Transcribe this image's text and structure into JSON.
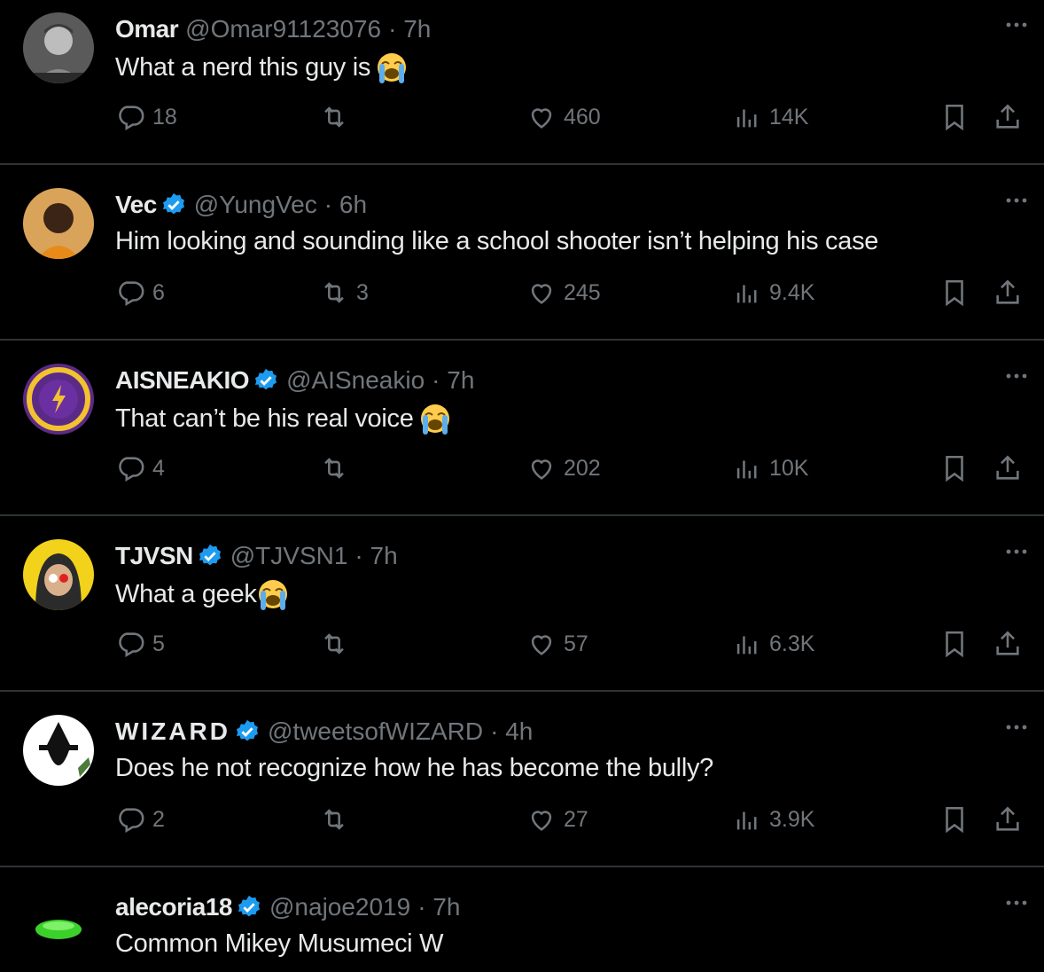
{
  "tweets": [
    {
      "name": "Omar",
      "verified": false,
      "handle": "@Omar91123076",
      "time": "· 7h",
      "text": "What a nerd this guy is",
      "emoji": "loudly-crying-face",
      "replies": "18",
      "retweets": "",
      "likes": "460",
      "views": "14K"
    },
    {
      "name": "Vec",
      "verified": true,
      "handle": "@YungVec",
      "time": "· 6h",
      "text": "Him looking and sounding like a school shooter isn’t helping his case",
      "emoji": "",
      "replies": "6",
      "retweets": "3",
      "likes": "245",
      "views": "9.4K"
    },
    {
      "name": "AISNEAKIO",
      "verified": true,
      "handle": "@AISneakio",
      "time": "· 7h",
      "text": "That can’t be his real voice",
      "emoji": "loudly-crying-face",
      "replies": "4",
      "retweets": "",
      "likes": "202",
      "views": "10K"
    },
    {
      "name": "TJVSN",
      "verified": true,
      "handle": "@TJVSN1",
      "time": "· 7h",
      "text": "What a geek",
      "emoji": "loudly-crying-face",
      "replies": "5",
      "retweets": "",
      "likes": "57",
      "views": "6.3K"
    },
    {
      "name": "WIZARD",
      "verified": true,
      "handle": "@tweetsofWIZARD",
      "time": "· 4h",
      "text": "Does he not recognize how he has become the bully?",
      "emoji": "",
      "replies": "2",
      "retweets": "",
      "likes": "27",
      "views": "3.9K"
    },
    {
      "name": "alecoria18",
      "verified": true,
      "handle": "@najoe2019",
      "time": "· 7h",
      "text": "Common Mikey Musumeci W",
      "emoji": ""
    }
  ],
  "colors": {
    "background": "#000000",
    "text": "#e7e9ea",
    "muted": "#71767b",
    "divider": "#2f3336",
    "verified": "#1d9bf0"
  },
  "icons": {
    "reply": "reply-icon",
    "retweet": "retweet-icon",
    "like": "heart-icon",
    "views": "views-icon",
    "bookmark": "bookmark-icon",
    "share": "share-icon",
    "more": "more-icon"
  }
}
